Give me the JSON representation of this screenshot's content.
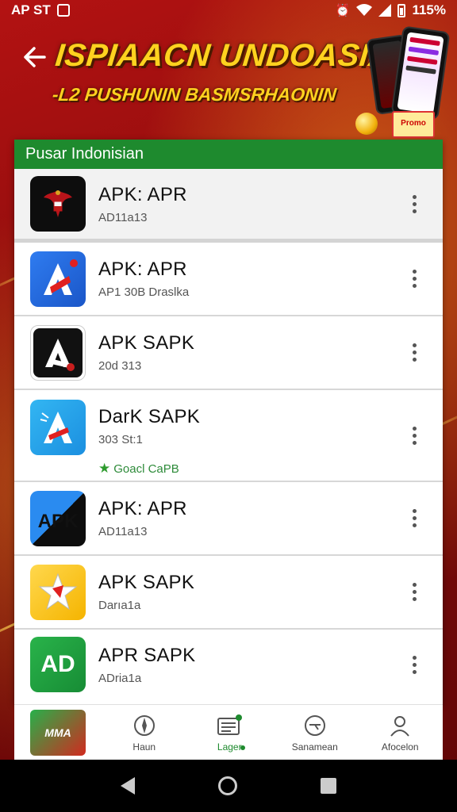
{
  "status_bar": {
    "left_text": "AP ST",
    "battery": "115%"
  },
  "banner": {
    "title": "ISPIAACN UNDOASIA",
    "subtitle": "-L2 PUSHUNIN BASMSRHAONIN",
    "promo_box_text": "Promo"
  },
  "list": {
    "header": "Pusar Indonisian",
    "apps": [
      {
        "name": "APK: APR",
        "sub": "AD11a13",
        "icon": "garuda-icon",
        "badge": ""
      },
      {
        "name": "APK: APR",
        "sub": "AP1 30B Draslka",
        "icon": "letter-a-blue-icon",
        "badge": ""
      },
      {
        "name": "APK SAPK",
        "sub": "20d 313",
        "icon": "letter-a-black-icon",
        "badge": ""
      },
      {
        "name": "DarK SAPK",
        "sub": "303 St:1",
        "icon": "letter-a-sky-icon",
        "badge": "Goacl CaPB"
      },
      {
        "name": "APK: APR",
        "sub": "AD11a13",
        "icon": "apk-split-icon",
        "icon_text": "APK",
        "badge": ""
      },
      {
        "name": "APK SAPK",
        "sub": "Darıa1a",
        "icon": "star-yellow-icon",
        "badge": ""
      },
      {
        "name": "APR SAPK",
        "sub": "ADria1a",
        "icon": "ad-green-icon",
        "icon_text": "AD",
        "badge": ""
      }
    ]
  },
  "bottom_nav": {
    "logo_text": "MMA",
    "tabs": [
      {
        "label": "Haun",
        "icon": "compass-icon"
      },
      {
        "label": "Lager",
        "icon": "library-icon"
      },
      {
        "label": "Sanamean",
        "icon": "search-icon"
      },
      {
        "label": "Afocelon",
        "icon": "account-icon"
      }
    ]
  },
  "colors": {
    "accent_green": "#1e8a2e",
    "banner_red": "#b31212",
    "banner_gold": "#ffd21f"
  }
}
